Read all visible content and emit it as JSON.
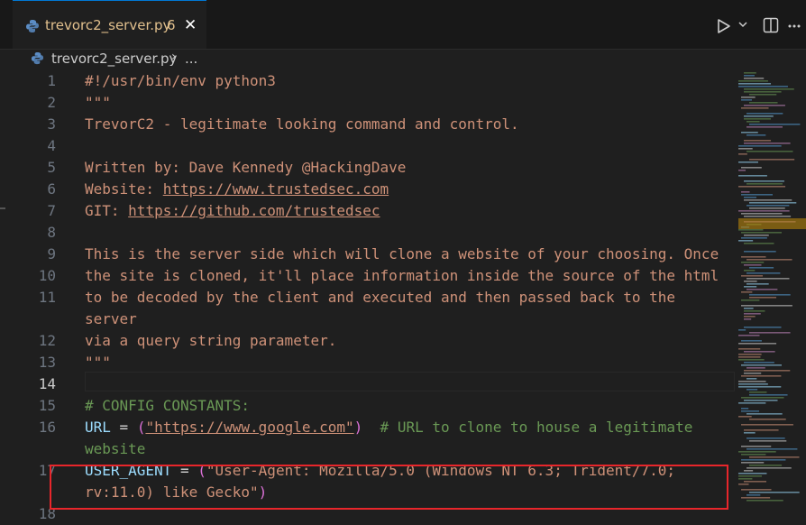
{
  "tab": {
    "filename": "trevorc2_server.py",
    "problems_count": "6",
    "close_glyph": "✕"
  },
  "breadcrumb": {
    "file": "trevorc2_server.py",
    "separator": "›",
    "more": "..."
  },
  "editor": {
    "active_line": "14",
    "lines": [
      {
        "n": "1",
        "text": "#!/usr/bin/env python3"
      },
      {
        "n": "2",
        "text": "\"\"\""
      },
      {
        "n": "3",
        "text": "TrevorC2 - legitimate looking command and control."
      },
      {
        "n": "4",
        "text": ""
      },
      {
        "n": "5",
        "text": "Written by: Dave Kennedy @HackingDave"
      },
      {
        "n": "6",
        "pre": "Website: ",
        "link": "https://www.trustedsec.com"
      },
      {
        "n": "7",
        "pre": "GIT: ",
        "link": "https://github.com/trustedsec"
      },
      {
        "n": "8",
        "text": ""
      },
      {
        "n": "9",
        "text": "This is the server side which will clone a website of your choosing. Once"
      },
      {
        "n": "10",
        "text": "the site is cloned, it'll place information inside the source of the html"
      },
      {
        "n": "11",
        "text": "to be decoded by the client and executed and then passed back to the"
      },
      {
        "n": "",
        "text": "server"
      },
      {
        "n": "12",
        "text": "via a query string parameter."
      },
      {
        "n": "13",
        "text": "\"\"\""
      },
      {
        "n": "14",
        "text": ""
      },
      {
        "n": "15",
        "text": "# CONFIG CONSTANTS:"
      },
      {
        "n": "16",
        "var": "URL",
        "eq": " = ",
        "open": "(",
        "str": "\"https://www.google.com\"",
        "close": ")",
        "comment": "  # URL to clone to house a legitimate"
      },
      {
        "n": "",
        "comment": "website"
      },
      {
        "n": "17",
        "var": "USER_AGENT",
        "eq": " = ",
        "open": "(",
        "str": "\"User-Agent: Mozilla/5.0 (Windows NT 6.3; Trident/7.0;"
      },
      {
        "n": "",
        "str": "rv:11.0) like Gecko\"",
        "close": ")"
      },
      {
        "n": "18",
        "text": ""
      }
    ]
  },
  "colors": {
    "string": "#ce9178",
    "comment": "#6a9955",
    "variable": "#9cdcfe",
    "tab_modified": "#e2c08d",
    "highlight_box": "#e8262b"
  },
  "icons": [
    "python-file-icon",
    "close-icon",
    "run-icon",
    "chevron-down-icon",
    "split-editor-icon",
    "more-actions-icon"
  ]
}
